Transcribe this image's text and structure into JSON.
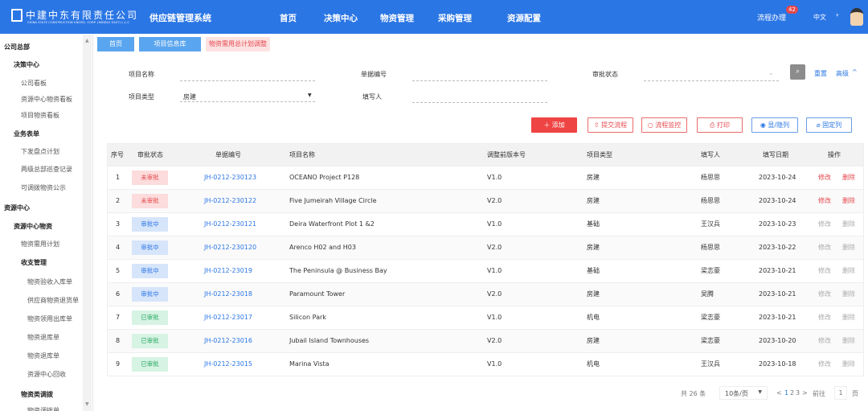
{
  "header": {
    "logo_cn": "中建中东有限责任公司",
    "logo_en": "CHINA STATE CONSTRUCTION ENGRG. CORP. (MIDDLE EAST) L.L.C",
    "system_title": "供应链管理系统",
    "nav": [
      "首页",
      "决策中心",
      "物资管理",
      "采购管理",
      "资源配置"
    ],
    "flow_label": "流程办理",
    "flow_badge": "42",
    "language": "中文",
    "brand_color": "#2b76e5"
  },
  "sidebar": {
    "items": [
      {
        "label": "公司总部",
        "level": 0
      },
      {
        "label": "决策中心",
        "level": 1
      },
      {
        "label": "公司看板",
        "level": 2
      },
      {
        "label": "资源中心物资看板",
        "level": 2
      },
      {
        "label": "项目物资看板",
        "level": 2
      },
      {
        "label": "业务表单",
        "level": 1
      },
      {
        "label": "下发盘点计划",
        "level": 2
      },
      {
        "label": "两级总部巡查记录",
        "level": 2
      },
      {
        "label": "可调拨物资公示",
        "level": 2
      },
      {
        "label": "资源中心",
        "level": 0
      },
      {
        "label": "资源中心物资",
        "level": 1
      },
      {
        "label": "物资需用计划",
        "level": 2
      },
      {
        "label": "收支管理",
        "level": 2,
        "bold": true
      },
      {
        "label": "物资验收入库单",
        "level": 3
      },
      {
        "label": "供应商物资退货单",
        "level": 3
      },
      {
        "label": "物资领用出库单",
        "level": 3
      },
      {
        "label": "物资退库单",
        "level": 3
      },
      {
        "label": "物资退库单",
        "level": 3
      },
      {
        "label": "资源中心回收",
        "level": 3
      },
      {
        "label": "物资类调拨",
        "level": 2,
        "bold": true
      },
      {
        "label": "物资调拨单",
        "level": 3
      }
    ]
  },
  "tabs": [
    "首页",
    "项目信息库",
    "物资需用总计划调整"
  ],
  "filters": {
    "project_name": {
      "label": "项目名称",
      "value": ""
    },
    "doc_no": {
      "label": "单据编号",
      "value": ""
    },
    "status": {
      "label": "审批状态",
      "value": ""
    },
    "project_type": {
      "label": "项目类型",
      "value": "房建"
    },
    "filler": {
      "label": "填写人",
      "value": ""
    },
    "reset": "重置",
    "advanced": "高级"
  },
  "actions": {
    "add": "添加",
    "submit": "提交流程",
    "monitor": "流程监控",
    "print": "打印",
    "show_hide": "显/隐列",
    "fix": "固定列"
  },
  "table": {
    "columns": [
      "序号",
      "审批状态",
      "单据编号",
      "项目名称",
      "调整前版本号",
      "项目类型",
      "填写人",
      "填写日期",
      "操作"
    ],
    "edit": "修改",
    "delete": "删除",
    "rows": [
      {
        "no": "1",
        "status": "未审批",
        "tone": "red",
        "code": "JH-0212-230123",
        "name": "OCEANO Project P128",
        "ver": "V1.0",
        "type": "房建",
        "user": "杨思思",
        "date": "2023-10-24",
        "active": true
      },
      {
        "no": "2",
        "status": "未审批",
        "tone": "red",
        "code": "JH-0212-230122",
        "name": "Five Jumeirah Village Circle",
        "ver": "V2.0",
        "type": "房建",
        "user": "杨思思",
        "date": "2023-10-24",
        "active": true
      },
      {
        "no": "3",
        "status": "审批中",
        "tone": "blue",
        "code": "JH-0212-230121",
        "name": "Deira Waterfront Plot 1 &2",
        "ver": "V1.0",
        "type": "基础",
        "user": "王汉兵",
        "date": "2023-10-23",
        "active": false
      },
      {
        "no": "4",
        "status": "审批中",
        "tone": "blue",
        "code": "JH-0212-230120",
        "name": "Arenco H02 and H03",
        "ver": "V2.0",
        "type": "房建",
        "user": "杨思思",
        "date": "2023-10-22",
        "active": false
      },
      {
        "no": "5",
        "status": "审批中",
        "tone": "blue",
        "code": "JH-0212-23019",
        "name": "The Peninsula @ Business Bay",
        "ver": "V1.0",
        "type": "基础",
        "user": "梁志豪",
        "date": "2023-10-21",
        "active": false
      },
      {
        "no": "6",
        "status": "审批中",
        "tone": "blue",
        "code": "JH-0212-23018",
        "name": "Paramount Tower",
        "ver": "V2.0",
        "type": "房建",
        "user": "吴腾",
        "date": "2023-10-21",
        "active": false
      },
      {
        "no": "7",
        "status": "已审批",
        "tone": "green",
        "code": "JH-0212-23017",
        "name": "Silicon Park",
        "ver": "V1.0",
        "type": "机电",
        "user": "梁志豪",
        "date": "2023-10-21",
        "active": false
      },
      {
        "no": "8",
        "status": "已审批",
        "tone": "green",
        "code": "JH-0212-23016",
        "name": "Jubail Island Townhouses",
        "ver": "V2.0",
        "type": "房建",
        "user": "梁志豪",
        "date": "2023-10-20",
        "active": false
      },
      {
        "no": "9",
        "status": "已审批",
        "tone": "green",
        "code": "JH-0212-23015",
        "name": "Marina Vista",
        "ver": "V1.0",
        "type": "机电",
        "user": "王汉兵",
        "date": "2023-10-18",
        "active": false
      }
    ]
  },
  "pagination": {
    "total": "共 26 条",
    "page_size": "10条/页",
    "pages": [
      "1",
      "2",
      "3"
    ],
    "current": "1",
    "goto": "前往",
    "goto_value": "1",
    "unit": "页"
  }
}
